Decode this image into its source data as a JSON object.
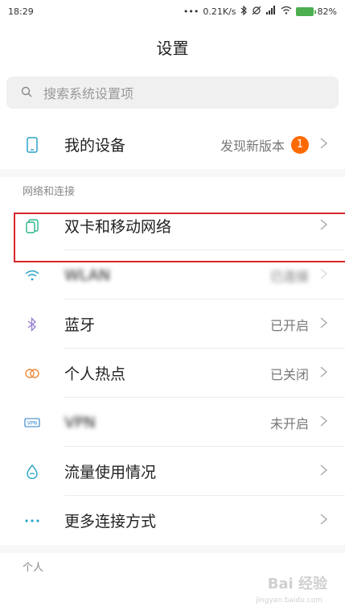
{
  "status": {
    "time": "18:29",
    "signal_dots": "•••",
    "speed": "0.21K/s",
    "battery": "82%"
  },
  "header": {
    "title": "设置"
  },
  "search": {
    "placeholder": "搜索系统设置项"
  },
  "device": {
    "label": "我的设备",
    "value": "发现新版本",
    "badge": "1"
  },
  "network_section": {
    "title": "网络和连接"
  },
  "items": [
    {
      "label": "双卡和移动网络",
      "value": ""
    },
    {
      "label": "WLAN",
      "value": "已连接"
    },
    {
      "label": "蓝牙",
      "value": "已开启"
    },
    {
      "label": "个人热点",
      "value": "已关闭"
    },
    {
      "label": "VPN",
      "value": "未开启"
    },
    {
      "label": "流量使用情况",
      "value": ""
    },
    {
      "label": "更多连接方式",
      "value": ""
    }
  ],
  "personal_section": {
    "title": "个人"
  },
  "watermark": {
    "text": "Bai 经验",
    "sub": "jingyan.baidu.com"
  },
  "colors": {
    "highlight": "#d9262c",
    "badge": "#ff6a00",
    "battery": "#4caf50"
  }
}
